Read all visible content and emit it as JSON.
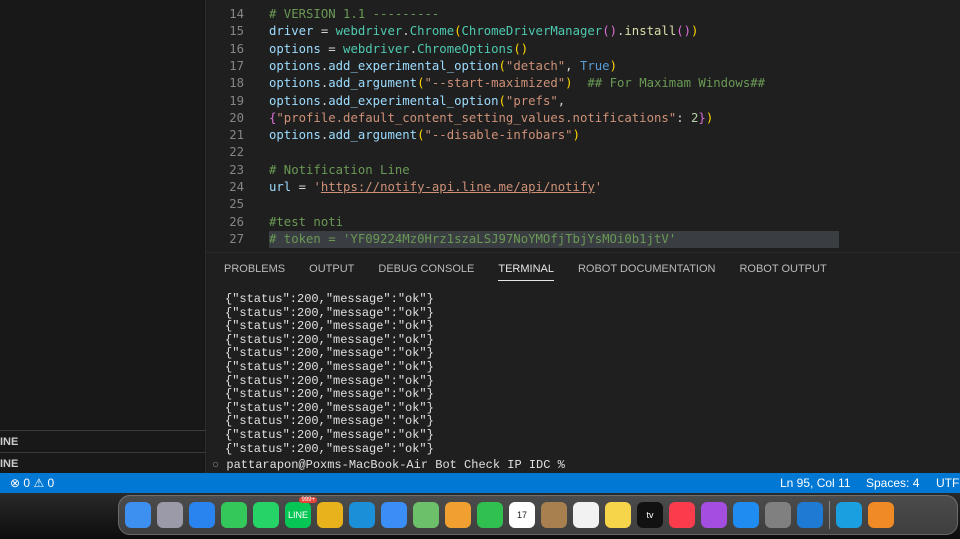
{
  "sidebar": {
    "sections": [
      "INE",
      "INE"
    ]
  },
  "editor": {
    "lines": [
      {
        "n": "14",
        "t": [
          [
            "# VERSION 1.1 ---------",
            "c"
          ]
        ]
      },
      {
        "n": "15",
        "t": [
          [
            "driver",
            "v"
          ],
          [
            " = ",
            "w"
          ],
          [
            "webdriver",
            "f"
          ],
          [
            ".",
            "w"
          ],
          [
            "Chrome",
            "f"
          ],
          [
            "(",
            "y"
          ],
          [
            "ChromeDriverManager",
            "f"
          ],
          [
            "()",
            "p"
          ],
          [
            ".",
            "w"
          ],
          [
            "install",
            "fn"
          ],
          [
            "()",
            "p"
          ],
          [
            ")",
            "y"
          ]
        ]
      },
      {
        "n": "16",
        "t": [
          [
            "options",
            "v"
          ],
          [
            " = ",
            "w"
          ],
          [
            "webdriver",
            "f"
          ],
          [
            ".",
            "w"
          ],
          [
            "ChromeOptions",
            "f"
          ],
          [
            "()",
            "y"
          ]
        ]
      },
      {
        "n": "17",
        "t": [
          [
            "options",
            "v"
          ],
          [
            ".",
            "w"
          ],
          [
            "add_experimental_option",
            "v"
          ],
          [
            "(",
            "y"
          ],
          [
            "\"detach\"",
            "s"
          ],
          [
            ", ",
            "w"
          ],
          [
            "True",
            "k"
          ],
          [
            ")",
            "y"
          ]
        ]
      },
      {
        "n": "18",
        "t": [
          [
            "options",
            "v"
          ],
          [
            ".",
            "w"
          ],
          [
            "add_argument",
            "v"
          ],
          [
            "(",
            "y"
          ],
          [
            "\"--start-maximized\"",
            "s"
          ],
          [
            ")",
            "y"
          ],
          [
            "  ## For Maximam Windows##",
            "c"
          ]
        ]
      },
      {
        "n": "19",
        "t": [
          [
            "options",
            "v"
          ],
          [
            ".",
            "w"
          ],
          [
            "add_experimental_option",
            "v"
          ],
          [
            "(",
            "y"
          ],
          [
            "\"prefs\"",
            "s"
          ],
          [
            ",",
            "w"
          ]
        ]
      },
      {
        "n": "20",
        "t": [
          [
            "{",
            "p"
          ],
          [
            "\"profile.default_content_setting_values.notifications\"",
            "s"
          ],
          [
            ": ",
            "w"
          ],
          [
            "2",
            "n"
          ],
          [
            "}",
            "p"
          ],
          [
            ")",
            "y"
          ]
        ]
      },
      {
        "n": "21",
        "t": [
          [
            "options",
            "v"
          ],
          [
            ".",
            "w"
          ],
          [
            "add_argument",
            "v"
          ],
          [
            "(",
            "y"
          ],
          [
            "\"--disable-infobars\"",
            "s"
          ],
          [
            ")",
            "y"
          ]
        ]
      },
      {
        "n": "22",
        "t": []
      },
      {
        "n": "23",
        "t": [
          [
            "# Notification Line",
            "c"
          ]
        ]
      },
      {
        "n": "24",
        "t": [
          [
            "url",
            "v"
          ],
          [
            " = ",
            "w"
          ],
          [
            "'",
            "s"
          ],
          [
            "https://notify-api.line.me/api/notify",
            "u"
          ],
          [
            "'",
            "s"
          ]
        ]
      },
      {
        "n": "25",
        "t": []
      },
      {
        "n": "26",
        "t": [
          [
            "#test noti",
            "c"
          ]
        ]
      },
      {
        "n": "27",
        "t": [
          [
            "# token = 'YF09224Mz0Hrz1szaLSJ97NoYMOfjTbjYsMOi0b1jtV'",
            "c"
          ]
        ],
        "hl": true
      }
    ]
  },
  "panel": {
    "tabs": [
      "PROBLEMS",
      "OUTPUT",
      "DEBUG CONSOLE",
      "TERMINAL",
      "ROBOT DOCUMENTATION",
      "ROBOT OUTPUT"
    ],
    "active": 3,
    "terminal_lines": [
      "{\"status\":200,\"message\":\"ok\"}",
      "{\"status\":200,\"message\":\"ok\"}",
      "{\"status\":200,\"message\":\"ok\"}",
      "{\"status\":200,\"message\":\"ok\"}",
      "{\"status\":200,\"message\":\"ok\"}",
      "{\"status\":200,\"message\":\"ok\"}",
      "{\"status\":200,\"message\":\"ok\"}",
      "{\"status\":200,\"message\":\"ok\"}",
      "{\"status\":200,\"message\":\"ok\"}",
      "{\"status\":200,\"message\":\"ok\"}",
      "{\"status\":200,\"message\":\"ok\"}",
      "{\"status\":200,\"message\":\"ok\"}"
    ],
    "prompt": "pattarapon@Poxms-MacBook-Air Bot Check IP IDC %"
  },
  "status": {
    "errors": "0",
    "warnings": "0",
    "position": "Ln 95, Col 11",
    "spaces": "Spaces: 4",
    "encoding": "UTF"
  },
  "dock": {
    "apps": [
      {
        "name": "finder",
        "color": "#3d8ff0"
      },
      {
        "name": "launchpad",
        "color": "#9a9aa8"
      },
      {
        "name": "safari",
        "color": "#2a84f0"
      },
      {
        "name": "messages",
        "color": "#34c759"
      },
      {
        "name": "whatsapp",
        "color": "#25d366"
      },
      {
        "name": "line",
        "color": "#06c755",
        "label": "LINE",
        "badge": "999+"
      },
      {
        "name": "chrome",
        "color": "#e8b21d"
      },
      {
        "name": "edge",
        "color": "#1b8fd8"
      },
      {
        "name": "mail",
        "color": "#3a8ef5"
      },
      {
        "name": "maps",
        "color": "#6cc06a"
      },
      {
        "name": "photos",
        "color": "#f0a030"
      },
      {
        "name": "facetime",
        "color": "#30c050"
      },
      {
        "name": "calendar",
        "color": "#ffffff",
        "label": "17"
      },
      {
        "name": "contacts",
        "color": "#a88050"
      },
      {
        "name": "reminders",
        "color": "#f2f2f2"
      },
      {
        "name": "notes",
        "color": "#f7d54a"
      },
      {
        "name": "tv",
        "color": "#111111",
        "label": "tv"
      },
      {
        "name": "music",
        "color": "#fa3c4c"
      },
      {
        "name": "podcasts",
        "color": "#a44ee0"
      },
      {
        "name": "app-store",
        "color": "#1e8cf0"
      },
      {
        "name": "system-settings",
        "color": "#808080"
      },
      {
        "name": "vscode",
        "color": "#1f7ad4"
      },
      {
        "name": "screen-share",
        "color": "#1aa0e0"
      },
      {
        "name": "vpn",
        "color": "#f08a24"
      }
    ]
  }
}
